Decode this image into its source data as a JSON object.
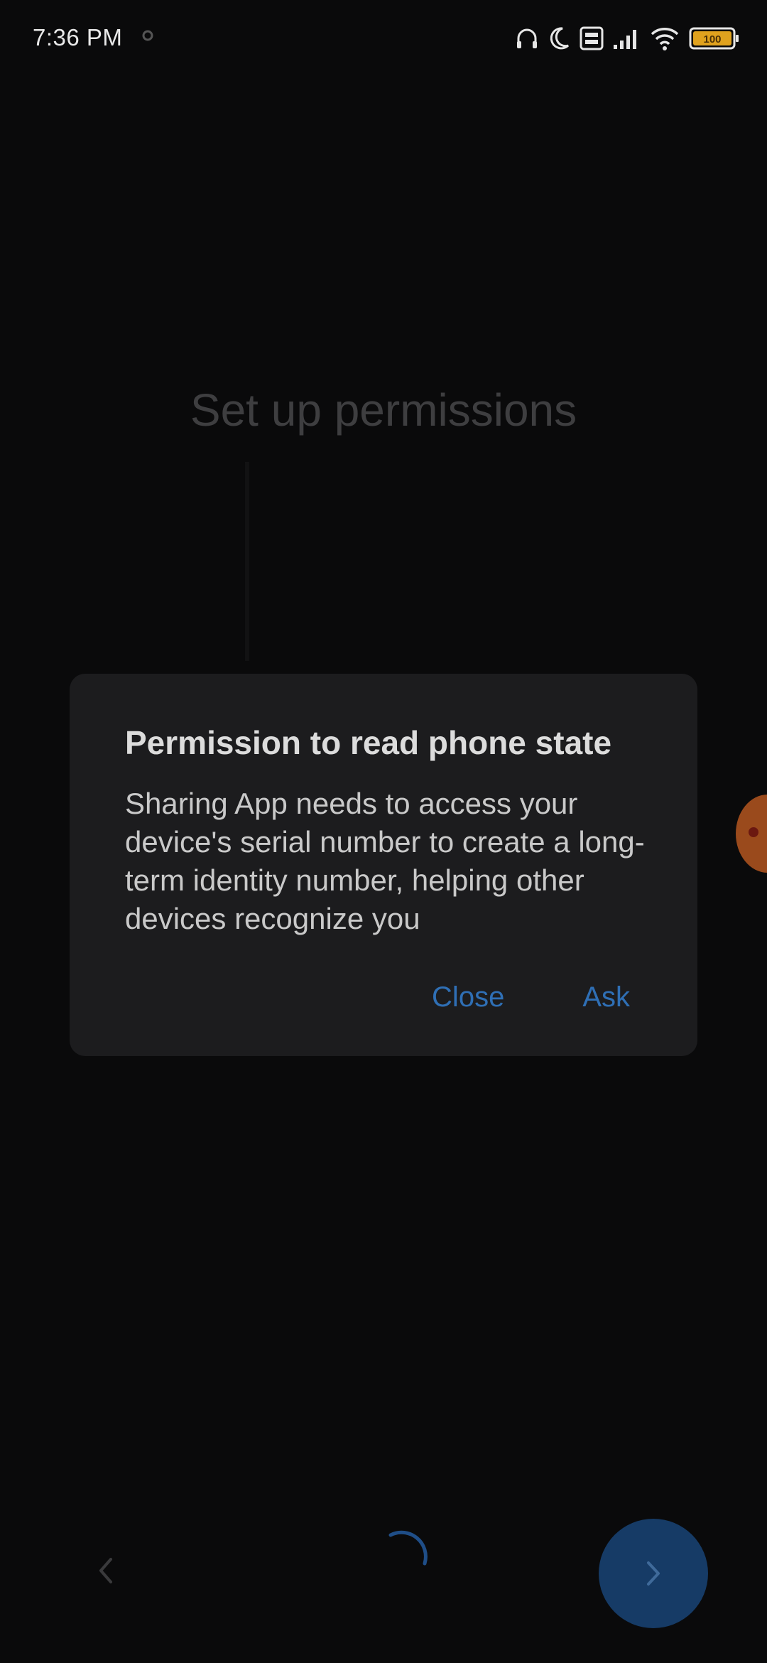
{
  "status_bar": {
    "time": "7:36 PM",
    "battery": "100"
  },
  "page": {
    "title": "Set up permissions"
  },
  "dialog": {
    "title": "Permission to read phone state",
    "body": "Sharing App needs to access your device's serial number to create a long-term identity number, helping other devices recognize you",
    "close_label": "Close",
    "ask_label": "Ask"
  },
  "icons": {
    "headphones": "headphones-icon",
    "moon": "moon-icon",
    "volte": "volte-icon",
    "signal": "signal-icon",
    "wifi": "wifi-icon",
    "battery": "battery-icon",
    "prev": "chevron-left-icon",
    "next": "chevron-right-icon",
    "spinner": "loading-spinner-icon"
  },
  "colors": {
    "accent": "#2f6fb5",
    "battery": "#e0a21e",
    "next_button": "#163b66",
    "dialog_bg": "#1c1c1e"
  }
}
